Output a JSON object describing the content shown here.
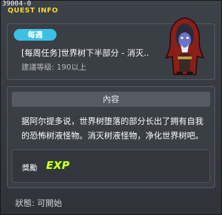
{
  "window": {
    "quest_id": "39004-0",
    "title": "QUEST INFO"
  },
  "summary": {
    "badge": "每週",
    "quest_title": "[每周任务]世界树下半部分 - 消灭..",
    "level_requirement": "建議等级: 190以上"
  },
  "content": {
    "header": "內容",
    "description": "据阿尔提多说，世界树堕落的部分长出了拥有自我的恐怖树液怪物。消灭树液怪物，净化世界树吧。",
    "reward_label": "獎勵",
    "reward_exp": "EXP"
  },
  "status": {
    "text": "狀態: 可開始"
  },
  "colors": {
    "badge": "#3cc0e4",
    "title": "#f2d633",
    "exp": "#e6ff3a"
  }
}
